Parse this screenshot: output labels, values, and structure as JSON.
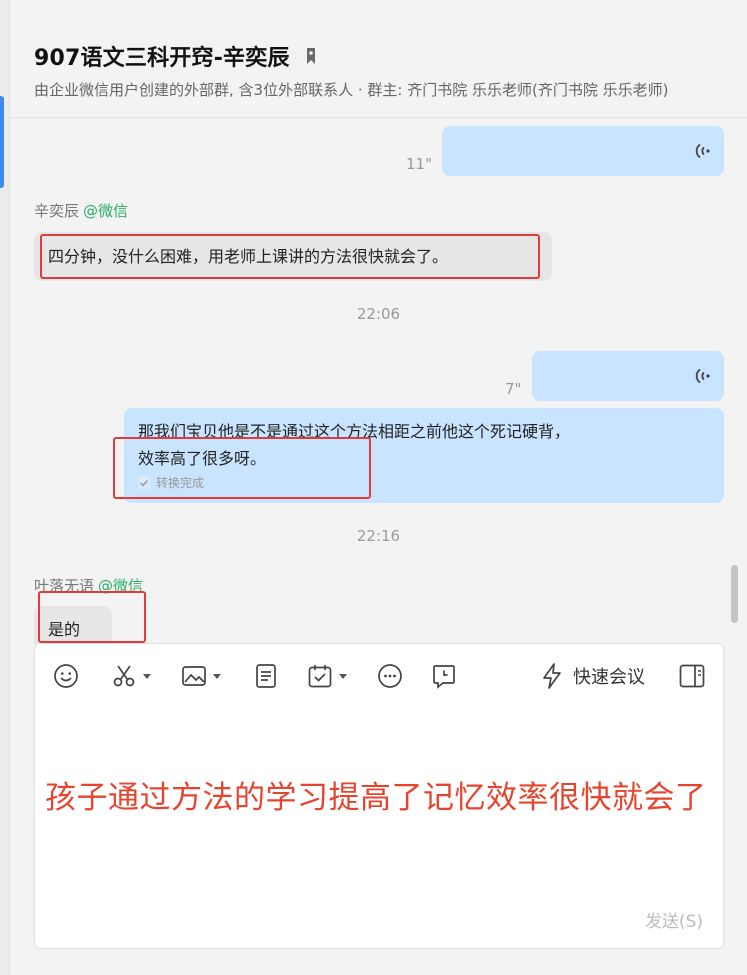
{
  "header": {
    "title": "907语文三科开窍-辛奕辰",
    "subtitle": "由企业微信用户创建的外部群, 含3位外部联系人 · 群主: 齐门书院 乐乐老师(齐门书院 乐乐老师)"
  },
  "messages": {
    "voice1_duration": "11\"",
    "sender1_name": "辛奕辰",
    "sender1_source": "@微信",
    "text1": "四分钟，没什么困难，用老师上课讲的方法很快就会了。",
    "time1": "22:06",
    "voice2_duration": "7\"",
    "transcript_line1": "那我们宝贝他是不是通过这个方法相距之前他这个死记硬背，",
    "transcript_line2": "效率高了很多呀。",
    "transcript_status": "转换完成",
    "time2": "22:16",
    "sender2_name": "叶落无语",
    "sender2_source": "@微信",
    "text2": "是的"
  },
  "composer": {
    "quick_meeting_label": "快速会议",
    "draft_text": "孩子通过方法的学习提高了记忆效率很快就会了",
    "send_label": "发送(S)"
  },
  "colors": {
    "my_bubble": "#c9e4ff",
    "other_bubble": "#e6e6e6",
    "wechat_green": "#2aae67",
    "annotation_red": "#e03b3b"
  },
  "icons": [
    "lock-icon",
    "voice-icon",
    "check-icon",
    "emoji-icon",
    "scissors-icon",
    "image-icon",
    "document-icon",
    "calendar-icon",
    "more-icon",
    "chat-history-icon",
    "lightning-icon",
    "sidebar-toggle-icon"
  ]
}
